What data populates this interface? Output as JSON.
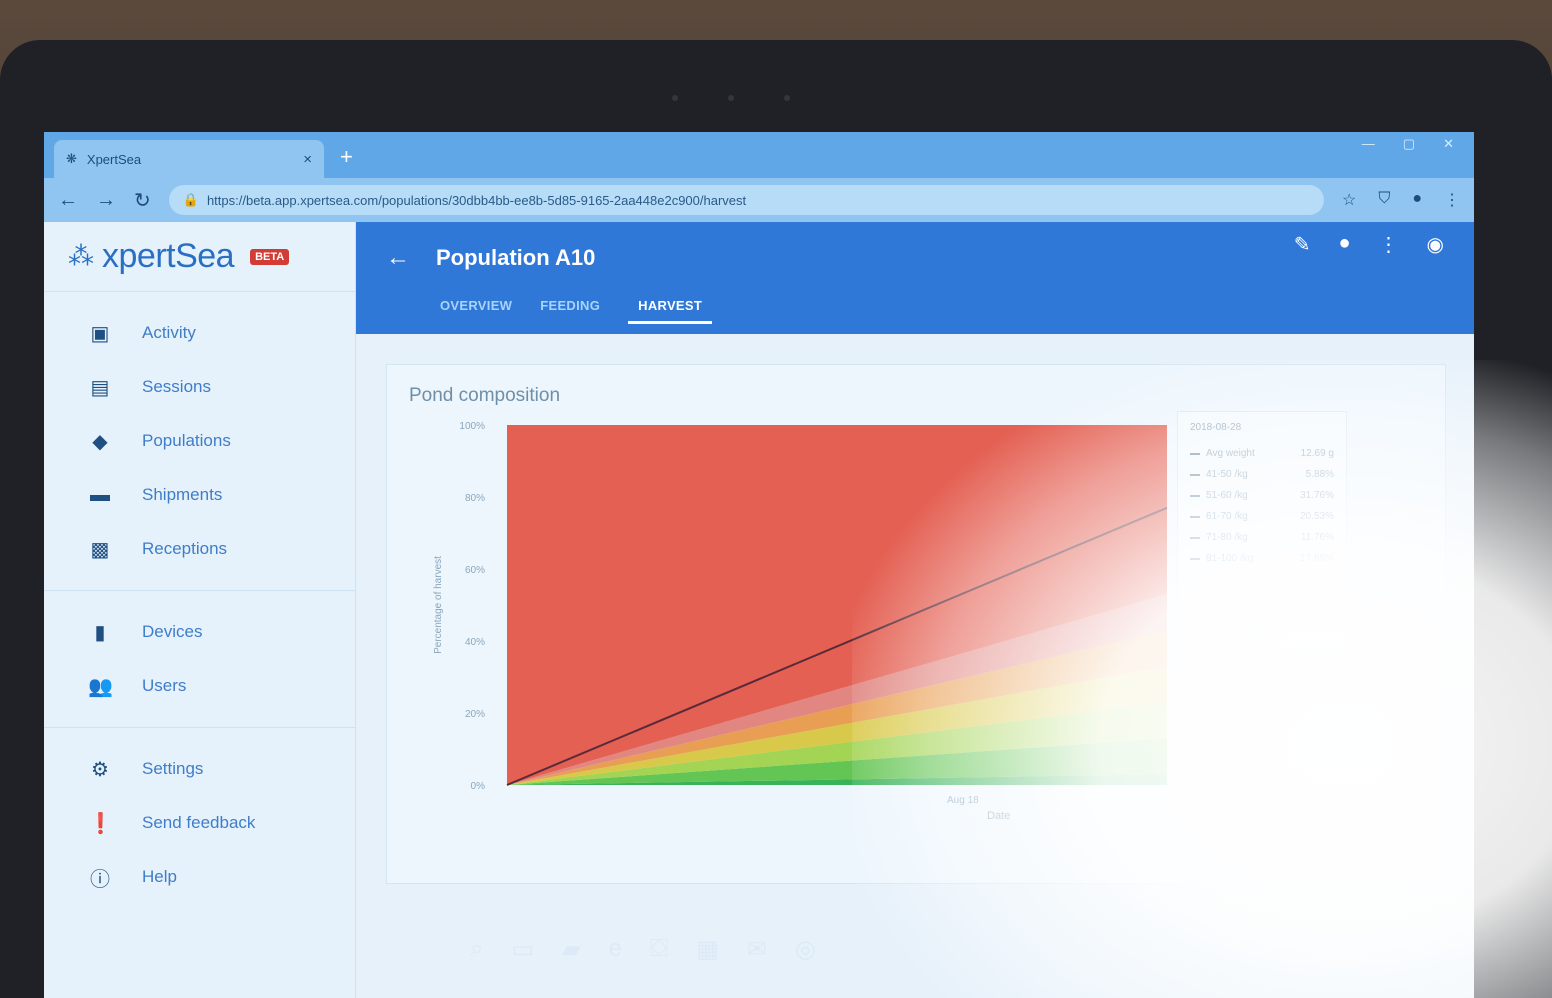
{
  "browser": {
    "tab_title": "XpertSea",
    "tab_close": "×",
    "new_tab": "+",
    "url": "https://beta.app.xpertsea.com/populations/30dbb4bb-ee8b-5d85-9165-2aa448e2c900/harvest"
  },
  "sidebar": {
    "brand": "xpertSea",
    "beta_badge": "BETA",
    "groups": [
      [
        {
          "label": "Activity",
          "icon": "inbox-icon"
        },
        {
          "label": "Sessions",
          "icon": "clipboard-icon"
        },
        {
          "label": "Populations",
          "icon": "tag-icon"
        },
        {
          "label": "Shipments",
          "icon": "truck-icon"
        },
        {
          "label": "Receptions",
          "icon": "receipt-icon"
        }
      ],
      [
        {
          "label": "Devices",
          "icon": "device-icon"
        },
        {
          "label": "Users",
          "icon": "users-icon"
        }
      ],
      [
        {
          "label": "Settings",
          "icon": "gear-icon"
        },
        {
          "label": "Send feedback",
          "icon": "feedback-icon"
        },
        {
          "label": "Help",
          "icon": "help-icon"
        }
      ]
    ]
  },
  "header": {
    "title": "Population A10",
    "tabs": [
      "OVERVIEW",
      "FEEDING",
      "HARVEST"
    ],
    "active_tab": "HARVEST"
  },
  "card": {
    "title": "Pond composition"
  },
  "chart_data": {
    "type": "area",
    "title": "Pond composition",
    "ylabel": "Percentage of harvest",
    "xlabel": "Date",
    "x_tick": "Aug 18",
    "y_ticks": [
      "100%",
      "80%",
      "60%",
      "40%",
      "20%",
      "0%"
    ],
    "ylim": [
      0,
      100
    ],
    "stacked": true,
    "colors": [
      "#2eaf4f",
      "#5cc24a",
      "#9fd24a",
      "#d8c640",
      "#e99a4a",
      "#e0807a",
      "#e4574a"
    ],
    "series_start": [
      0,
      0,
      0,
      0,
      0,
      0,
      100
    ],
    "series_end": [
      3,
      10,
      10,
      10,
      10,
      10,
      47
    ],
    "avg_line_end": 77,
    "legend": {
      "date": "2018-08-28",
      "rows": [
        {
          "label": "Avg weight",
          "value": "12.69 g"
        },
        {
          "label": "41-50 /kg",
          "value": "5.88%"
        },
        {
          "label": "51-60 /kg",
          "value": "31.76%"
        },
        {
          "label": "61-70 /kg",
          "value": "20.53%"
        },
        {
          "label": "71-80 /kg",
          "value": "11.76%"
        },
        {
          "label": "81-100 /kg",
          "value": "17.65%"
        }
      ]
    }
  },
  "taskbar": [
    "search-icon",
    "task-view-icon",
    "file-explorer-icon",
    "edge-icon",
    "store-icon",
    "calendar-icon",
    "mail-icon",
    "chrome-icon"
  ]
}
